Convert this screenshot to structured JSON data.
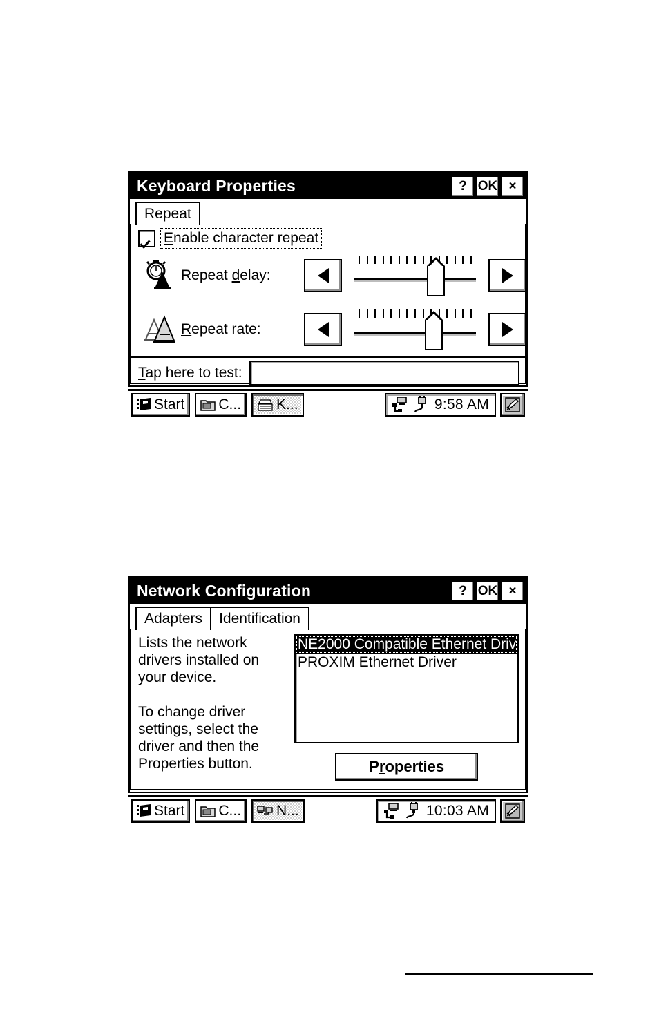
{
  "dialog_keyboard": {
    "title": "Keyboard Properties",
    "titlebar_buttons": [
      {
        "name": "help-button",
        "label": "?"
      },
      {
        "name": "ok-button",
        "label": "OK"
      },
      {
        "name": "close-button",
        "label": "×"
      }
    ],
    "tabs": [
      {
        "label": "Repeat",
        "active": true
      }
    ],
    "checkbox": {
      "label_prefix": "E",
      "label_rest": "nable character repeat",
      "checked": true
    },
    "repeat_delay": {
      "icon": "stopwatch-letter-a-icon",
      "label_prefix": "Repeat ",
      "label_accel": "d",
      "label_rest": "elay:",
      "decrement_label": "◀",
      "increment_label": "▶",
      "tick_count": 15,
      "thumb_percent": 70
    },
    "repeat_rate": {
      "icon": "double-letter-a-icon",
      "label_prefix": "",
      "label_accel": "R",
      "label_rest": "epeat rate:",
      "decrement_label": "◀",
      "increment_label": "▶",
      "tick_count": 15,
      "thumb_percent": 68
    },
    "test_field": {
      "label_accel": "T",
      "label_rest": "ap here to test:",
      "value": "",
      "placeholder": ""
    },
    "taskbar": {
      "start_label": "Start",
      "buttons": [
        {
          "name": "taskbar-item-control-panel",
          "label": "C...",
          "icon": "control-panel-icon",
          "pressed": false
        },
        {
          "name": "taskbar-item-keyboard",
          "label": "K...",
          "icon": "keyboard-icon",
          "pressed": true
        }
      ],
      "tray": {
        "network_icon": "network-pc-icon",
        "power_icon": "power-plug-icon",
        "clock": "9:58 AM",
        "stylus_icon": "stylus-pen-icon"
      }
    }
  },
  "dialog_network": {
    "title": "Network Configuration",
    "titlebar_buttons": [
      {
        "name": "help-button",
        "label": "?"
      },
      {
        "name": "ok-button",
        "label": "OK"
      },
      {
        "name": "close-button",
        "label": "×"
      }
    ],
    "tabs": [
      {
        "label": "Adapters",
        "active": true
      },
      {
        "label": "Identification",
        "active": false
      }
    ],
    "description": "Lists the network drivers installed on your device.\n\nTo change driver settings, select the driver and then the Properties button.",
    "adapter_list": [
      {
        "label": "NE2000 Compatible Ethernet Driv",
        "selected": true
      },
      {
        "label": "PROXIM Ethernet Driver",
        "selected": false
      }
    ],
    "properties_button": {
      "label_prefix": "P",
      "label_accel": "r",
      "label_rest": "operties"
    },
    "taskbar": {
      "start_label": "Start",
      "buttons": [
        {
          "name": "taskbar-item-control-panel",
          "label": "C...",
          "icon": "control-panel-icon",
          "pressed": false
        },
        {
          "name": "taskbar-item-network",
          "label": "N...",
          "icon": "network-icon",
          "pressed": true
        }
      ],
      "tray": {
        "network_icon": "network-pc-icon",
        "power_icon": "power-plug-icon",
        "clock": "10:03 AM",
        "stylus_icon": "stylus-pen-icon"
      }
    }
  },
  "page": {
    "background": "#ffffff",
    "rule_color": "#000000"
  }
}
